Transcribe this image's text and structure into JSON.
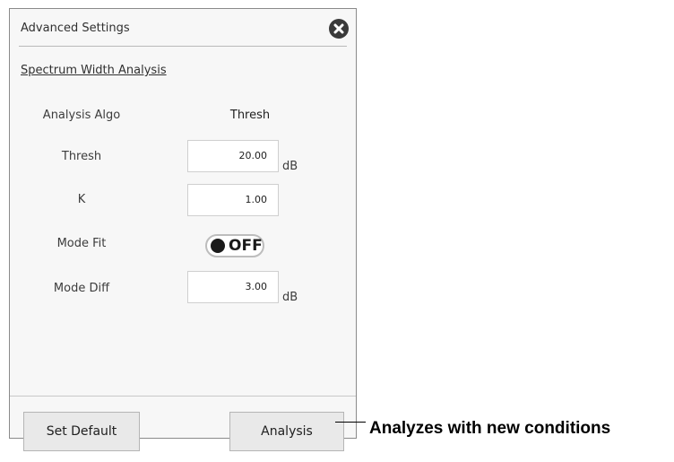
{
  "dialog": {
    "title": "Advanced Settings",
    "close_icon": "close-circle-icon",
    "section_label": "Spectrum Width Analysis"
  },
  "settings": {
    "analysis_algo": {
      "label": "Analysis Algo",
      "value": "Thresh"
    },
    "thresh": {
      "label": "Thresh",
      "value": "20.00",
      "unit": "dB"
    },
    "k": {
      "label": "K",
      "value": "1.00"
    },
    "mode_fit": {
      "label": "Mode Fit",
      "state": "OFF"
    },
    "mode_diff": {
      "label": "Mode Diff",
      "value": "3.00",
      "unit": "dB"
    }
  },
  "footer": {
    "set_default_label": "Set Default",
    "analysis_label": "Analysis"
  },
  "annotation": {
    "callout_text": "Analyzes with new conditions"
  }
}
